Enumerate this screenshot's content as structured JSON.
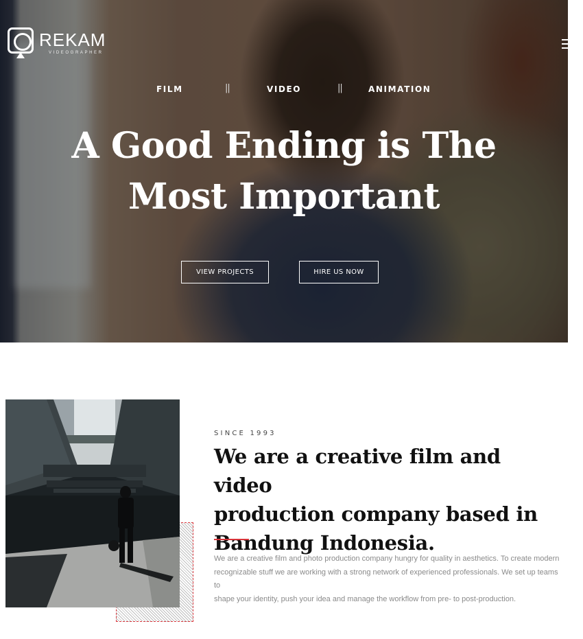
{
  "brand": {
    "name": "REKAM",
    "tagline": "VIDEOGRAPHER"
  },
  "nav": {
    "items": [
      {
        "label": "FILM"
      },
      {
        "label": "VIDEO"
      },
      {
        "label": "ANIMATION"
      }
    ],
    "separator": "||"
  },
  "hero": {
    "title_line1": "A Good Ending is The",
    "title_line2": "Most Important",
    "buttons": {
      "primary": "VIEW PROJECTS",
      "secondary": "HIRE US NOW"
    }
  },
  "about": {
    "eyebrow": "SINCE 1993",
    "title_line1": "We are a creative film and video",
    "title_line2": "production company based in",
    "title_line3": "Bandung Indonesia.",
    "body_line1": "We are a creative film and photo production company hungry for quality in aesthetics. To create modern",
    "body_line2": "recognizable stuff we are working with a strong network of experienced professionals. We set up teams to",
    "body_line3": "shape your identity, push your idea and manage the workflow from pre- to post-production."
  },
  "colors": {
    "accent": "#d8343a",
    "hero_text": "#ffffff",
    "body_text": "#8a8a8a"
  },
  "icons": {
    "logo": "camera-icon",
    "menu": "hamburger-menu-icon"
  }
}
